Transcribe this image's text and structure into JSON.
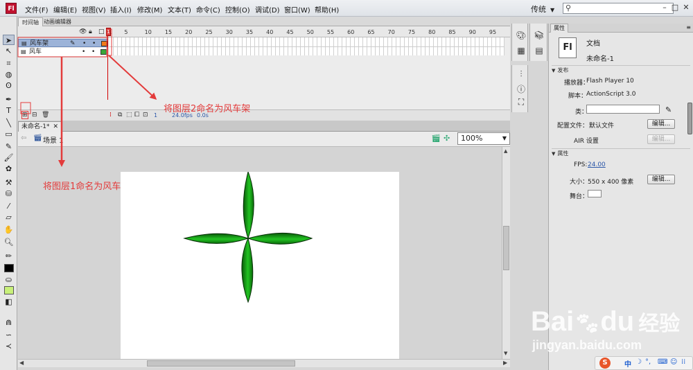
{
  "app": {
    "logo": "Fl",
    "menu": [
      "文件(F)",
      "编辑(E)",
      "视图(V)",
      "插入(I)",
      "修改(M)",
      "文本(T)",
      "命令(C)",
      "控制(O)",
      "调试(D)",
      "窗口(W)",
      "帮助(H)"
    ],
    "workspace": "传统",
    "window_buttons": [
      "–",
      "□",
      "✕"
    ]
  },
  "timeline": {
    "tabs": [
      "时间轴",
      "动画编辑器"
    ],
    "ruler": [
      "1",
      "5",
      "10",
      "15",
      "20",
      "25",
      "30",
      "35",
      "40",
      "45",
      "50",
      "55",
      "60",
      "65",
      "70",
      "75",
      "80",
      "85",
      "90",
      "95"
    ],
    "layers": [
      {
        "name": "风车架",
        "selected": true,
        "color": "#f07a1a"
      },
      {
        "name": "风车",
        "selected": false,
        "color": "#3aa83a"
      }
    ],
    "footer": {
      "frame": "1",
      "fps": "24.0fps",
      "time": "0.0s"
    }
  },
  "document": {
    "tab": "未命名-1*",
    "scene": "场景 1",
    "zoom": "100%"
  },
  "annotations": {
    "layer2": "将图层2命名为风车架",
    "layer1": "将图层1命名为风车"
  },
  "properties": {
    "tab": "属性",
    "doc_type": "文档",
    "doc_name": "未命名-1",
    "fl_icon": "Fl",
    "section_publish": "发布",
    "player_label": "播放器：",
    "player_value": "Flash Player 10",
    "script_label": "脚本：",
    "script_value": "ActionScript 3.0",
    "class_label": "类：",
    "profile_label": "配置文件：",
    "profile_value": "默认文件",
    "air_label": "AIR 设置",
    "edit_btn": "编辑...",
    "section_props": "属性",
    "fps_label": "FPS:",
    "fps_value": "24.00",
    "size_label": "大小：",
    "size_value": "550 x 400 像素",
    "stage_label": "舞台："
  },
  "watermark": {
    "brand": "Bai",
    "brand2": "du",
    "cn": "经验",
    "url": "jingyan.baidu.com"
  },
  "tray": {
    "ime": "中"
  },
  "colors": {
    "annotation": "#e33b3b",
    "windmill_green": "#22c322",
    "stage_color": "#ffffff",
    "fill_swatch": "#c8f07a"
  }
}
